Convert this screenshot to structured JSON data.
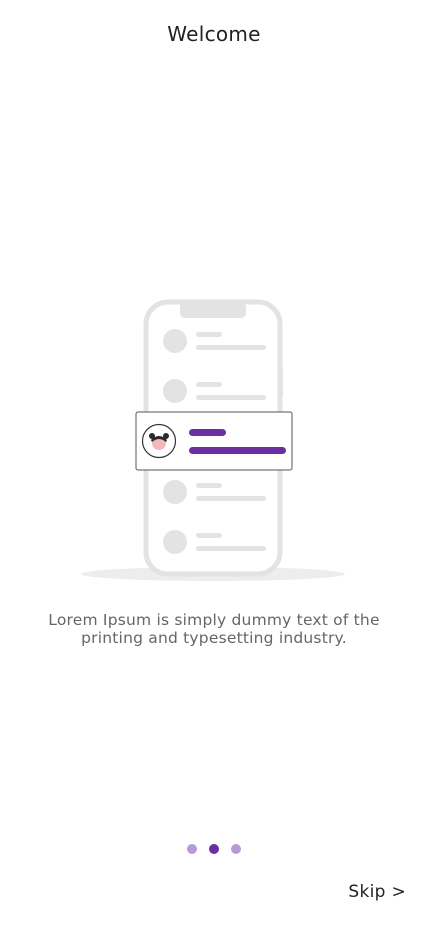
{
  "header": {
    "title": "Welcome"
  },
  "onboarding": {
    "description": "Lorem Ipsum is simply dummy text of the printing and typesetting industry.",
    "page_indicator": {
      "total": 3,
      "active_index": 1
    }
  },
  "footer": {
    "skip_label": "Skip >"
  },
  "colors": {
    "accent": "#6a2fa0",
    "accent_light": "#b89ad6",
    "illustration_gray": "#e5e5e5"
  },
  "illustration": {
    "icon": "phone-chat-list-illustration"
  }
}
